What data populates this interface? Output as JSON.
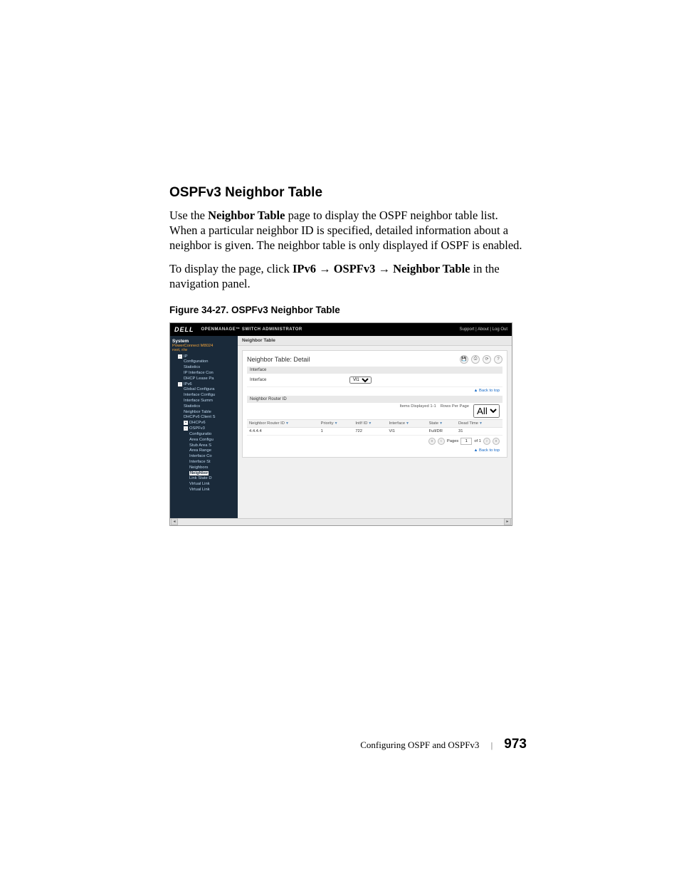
{
  "heading": "OSPFv3 Neighbor Table",
  "para1_pre": "Use the ",
  "para1_bold": "Neighbor Table",
  "para1_post": " page to display the OSPF neighbor table list. When a particular neighbor ID is specified, detailed information about a neighbor is given. The neighbor table is only displayed if OSPF is enabled.",
  "para2_pre": "To display the page, click ",
  "para2_ipv6": "IPv6",
  "para2_ospf": "OSPFv3",
  "para2_nt": "Neighbor Table",
  "para2_post": " in the navigation panel.",
  "arrow": "→",
  "figcap": "Figure 34-27.    OSPFv3 Neighbor Table",
  "shot": {
    "brand": "DELL",
    "product": "OPENMANAGE™ SWITCH ADMINISTRATOR",
    "toplinks": "Support  |  About  |  Log Out",
    "sidebar": {
      "system": "System",
      "model": "PowerConnect M8024",
      "user": "root, r/w",
      "tree": {
        "ip": "IP",
        "ip_cfg": "Configuration",
        "ip_stats": "Statistics",
        "ip_if": "IP Interface Con",
        "ip_dhcp": "DHCP Lease Pa",
        "ipv6": "IPv6",
        "gc": "Global Configura",
        "ic": "Interface Configu",
        "isum": "Interface Summ",
        "stats": "Statistics",
        "nt": "Neighbor Table",
        "dhcpc": "DHCPv6 Client S",
        "dhcpv6": "DHCPv6",
        "ospfv3": "OSPFv3",
        "ocfg": "Configuratio",
        "oarea": "Area Configu",
        "ostub": "Stub Area S",
        "orange": "Area Range",
        "oifcfg": "Interface Co",
        "oifst": "Interface St",
        "oneigh": "Neighbors",
        "onbtbl": "Neighbor",
        "olsd": "Link State D",
        "ovlink": "Virtual Link",
        "ovlinks": "Virtual Link"
      }
    },
    "crumb": "Neighbor Table",
    "panel_title": "Neighbor Table: Detail",
    "sec_interface": "Interface",
    "fld_interface": "Interface",
    "fld_interface_val": "Vl1",
    "sec_nrid": "Neighbor Router ID",
    "back_top": "▲ Back to top",
    "items_disp": "Items Displayed 1-1",
    "rows_pp": "Rows Per Page",
    "rows_pp_val": "All",
    "cols": {
      "nrid": "Neighbor Router ID",
      "prio": "Priority",
      "intfid": "IntIf ID",
      "iface": "Interface",
      "state": "State",
      "dead": "Dead Time"
    },
    "row": {
      "nrid": "4.4.4.4",
      "prio": "1",
      "intfid": "722",
      "iface": "Vl1",
      "state": "Full/DR",
      "dead": "31"
    },
    "pager": {
      "pages": "Pages",
      "cur": "1",
      "of": "of 1"
    }
  },
  "footer": {
    "chapter": "Configuring OSPF and OSPFv3",
    "pageno": "973"
  }
}
